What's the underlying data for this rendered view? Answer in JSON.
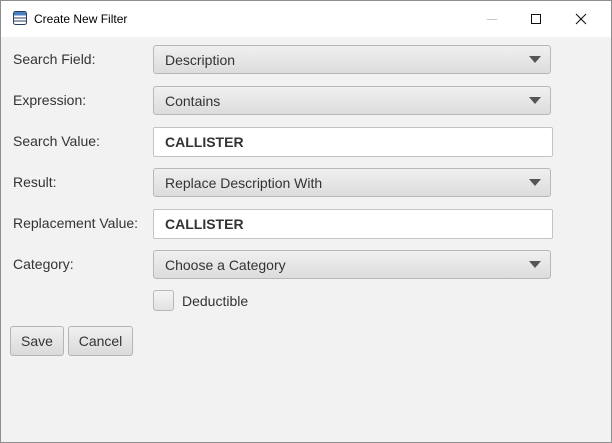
{
  "window": {
    "title": "Create New Filter",
    "controls": [
      "minimize-icon",
      "maximize-icon",
      "close-icon"
    ]
  },
  "form": {
    "search_field": {
      "label": "Search Field:",
      "value": "Description"
    },
    "expression": {
      "label": "Expression:",
      "value": "Contains"
    },
    "search_value": {
      "label": "Search Value:",
      "value": "CALLISTER"
    },
    "result": {
      "label": "Result:",
      "value": "Replace Description With"
    },
    "replacement_value": {
      "label": "Replacement Value:",
      "value": "CALLISTER"
    },
    "category": {
      "label": "Category:",
      "value": "Choose a Category"
    },
    "deductible": {
      "label": "Deductible",
      "checked": false
    }
  },
  "buttons": {
    "save": "Save",
    "cancel": "Cancel"
  },
  "colors": {
    "background": "#f2f2f2",
    "titlebar": "#ffffff",
    "text": "#333333"
  }
}
